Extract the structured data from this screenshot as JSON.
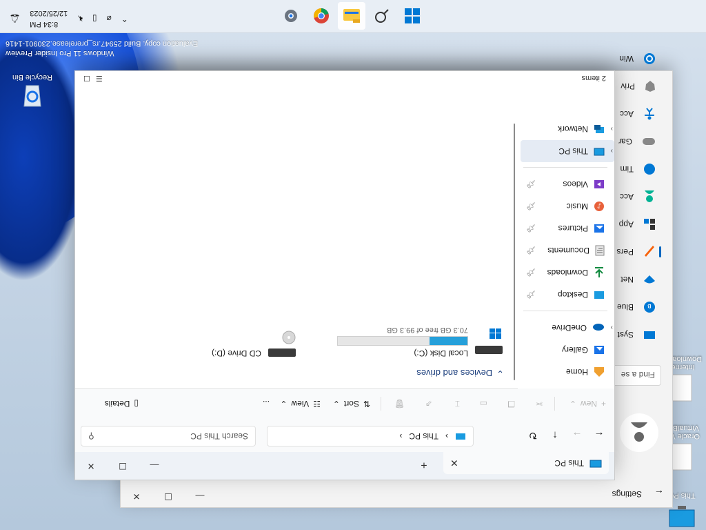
{
  "desktop": {
    "recycle_bin_label": "Recycle Bin",
    "watermark_line1": "Windows 11 Pro Insider Preview",
    "watermark_line2": "Evaluation copy. Build 25947.rs_prerelease.230901-1416",
    "left_icons": [
      {
        "label": "This PC"
      },
      {
        "label": "Oracle VM VirtualBox"
      },
      {
        "label": "Internet Download..."
      }
    ]
  },
  "taskbar": {
    "apps": [
      "start",
      "search",
      "file-explorer",
      "chrome",
      "settings"
    ],
    "clock_time": "8:34 PM",
    "clock_date": "12/25/2023"
  },
  "settings_window": {
    "title": "Settings",
    "search_placeholder": "Find a se",
    "nav": [
      {
        "label": "Syst",
        "icon": "monitor-icon",
        "color": "#0078d4"
      },
      {
        "label": "Blue",
        "icon": "bluetooth-icon",
        "color": "#0078d4"
      },
      {
        "label": "Net",
        "icon": "wifi-icon",
        "color": "#0078d4"
      },
      {
        "label": "Pers",
        "icon": "brush-icon",
        "color": "#f7630c",
        "active": true
      },
      {
        "label": "App",
        "icon": "apps-icon",
        "color": "#333333"
      },
      {
        "label": "Acc",
        "icon": "account-icon",
        "color": "#00b294"
      },
      {
        "label": "Tim",
        "icon": "globe-icon",
        "color": "#0078d4"
      },
      {
        "label": "Gar",
        "icon": "gamepad-icon",
        "color": "#777777"
      },
      {
        "label": "Acc",
        "icon": "accessibility-icon",
        "color": "#0078d4"
      },
      {
        "label": "Priv",
        "icon": "shield-icon",
        "color": "#777777"
      },
      {
        "label": "Win",
        "icon": "update-icon",
        "color": "#0078d4"
      }
    ]
  },
  "explorer": {
    "tab_title": "This PC",
    "address_label": "This PC",
    "search_placeholder": "Search This PC",
    "commands": {
      "new": "New",
      "sort": "Sort",
      "view": "View",
      "more": "...",
      "details": "Details"
    },
    "nav_pane": {
      "top": [
        {
          "label": "Home",
          "icon": "home-icon"
        },
        {
          "label": "Gallery",
          "icon": "gallery-icon"
        },
        {
          "label": "OneDrive",
          "icon": "cloud-icon",
          "expandable": true
        }
      ],
      "quick": [
        {
          "label": "Desktop",
          "icon": "desktop-icon"
        },
        {
          "label": "Downloads",
          "icon": "download-icon"
        },
        {
          "label": "Documents",
          "icon": "document-icon"
        },
        {
          "label": "Pictures",
          "icon": "pictures-icon"
        },
        {
          "label": "Music",
          "icon": "music-icon"
        },
        {
          "label": "Videos",
          "icon": "videos-icon"
        }
      ],
      "bottom": [
        {
          "label": "This PC",
          "icon": "computer-icon",
          "selected": true
        },
        {
          "label": "Network",
          "icon": "network-icon"
        }
      ]
    },
    "group_header": "Devices and drives",
    "drives": [
      {
        "name": "Local Disk (C:)",
        "free_text": "70.3 GB free of 99.3 GB",
        "used_fraction": 0.292
      },
      {
        "name": "CD Drive (D:)"
      }
    ],
    "status_text": "2 items"
  },
  "colors": {
    "accent": "#0078d4",
    "drive_bar": "#26a0da"
  }
}
